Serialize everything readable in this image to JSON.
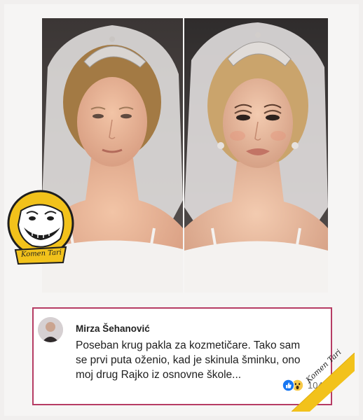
{
  "post": {
    "photos": [
      {
        "label": "before"
      },
      {
        "label": "after"
      }
    ]
  },
  "watermark": {
    "text": "Komen Tari",
    "badge_color": "#f2c21b",
    "ribbon_color": "#f2c21b"
  },
  "comment": {
    "author": "Mirza Šehanović",
    "lines": [
      "Poseban krug pakla za kozmetičare. Tako sam",
      "se prvi puta oženio, kad je skinula šminku, ono",
      "moj drug Rajko iz osnovne škole..."
    ],
    "reaction_icons": [
      "like-icon",
      "wow-icon"
    ],
    "reaction_count": "104",
    "border_color": "#b63c64"
  }
}
